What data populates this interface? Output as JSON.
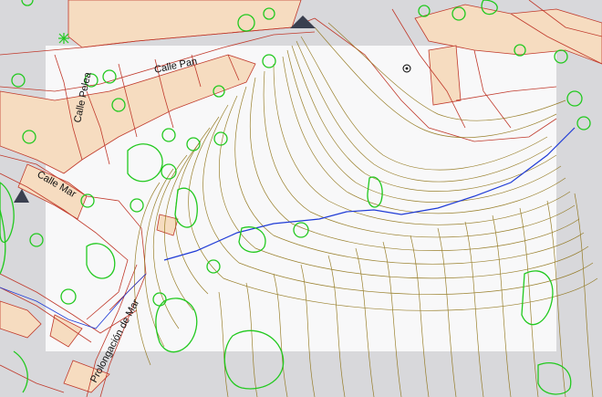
{
  "map": {
    "street_labels": {
      "calle_pan": "Calle Pan",
      "calle_pelea": "Calle Pelea",
      "calle_mar": "Calle Mar",
      "prolongacion_de_mar": "Prolongación de Mar"
    },
    "colors": {
      "background": "#d8d8db",
      "study_area": "#ffffff",
      "building_fill": "#f6dcc0",
      "parcel_lines": "#c0392b",
      "contour_lines": "#8a6d0b",
      "vegetation": "#22c91f",
      "path_line": "#1f3bd6",
      "marker": "#3a3f4f"
    },
    "markers": [
      "north-triangle-marker",
      "west-triangle-marker"
    ],
    "symbols": [
      "survey-point-icon",
      "palm-tree-icon"
    ]
  }
}
